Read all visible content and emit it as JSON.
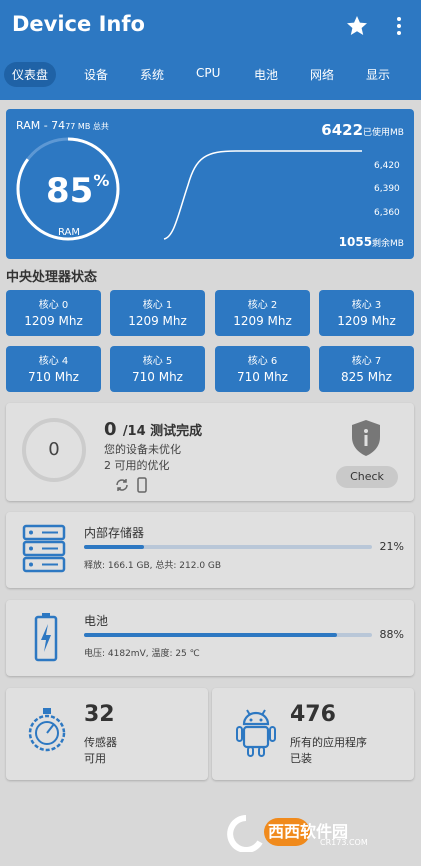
{
  "app": {
    "title": "Device Info"
  },
  "tabs": [
    "仪表盘",
    "设备",
    "系统",
    "CPU",
    "电池",
    "网络",
    "显示"
  ],
  "ram": {
    "label_prefix": "RAM - 74",
    "label_small": "77 MB 总共",
    "used_value": "6422",
    "used_unit": "已使用MB",
    "free_value": "1055",
    "free_unit": "剩余MB",
    "percent": "85",
    "percent_sign": "%",
    "ram_label": "RAM",
    "ticks": [
      "6,420",
      "6,390",
      "6,360"
    ],
    "gauge_fraction": 0.85
  },
  "cpu": {
    "title": "中央处理器状态",
    "cores": [
      {
        "name": "核心 0",
        "freq": "1209 Mhz"
      },
      {
        "name": "核心 1",
        "freq": "1209 Mhz"
      },
      {
        "name": "核心 2",
        "freq": "1209 Mhz"
      },
      {
        "name": "核心 3",
        "freq": "1209 Mhz"
      },
      {
        "name": "核心 4",
        "freq": "710 Mhz"
      },
      {
        "name": "核心 5",
        "freq": "710 Mhz"
      },
      {
        "name": "核心 6",
        "freq": "710 Mhz"
      },
      {
        "name": "核心 7",
        "freq": "825 Mhz"
      }
    ]
  },
  "test": {
    "circle_value": "0",
    "count": "0",
    "count_rest": "/14 测试完成",
    "line1": "您的设备未优化",
    "line2": "2 可用的优化",
    "check_label": "Check"
  },
  "storage": {
    "title": "内部存储器",
    "percent": "21%",
    "fraction": 0.21,
    "detail": "释放: 166.1 GB, 总共: 212.0 GB"
  },
  "battery": {
    "title": "电池",
    "percent": "88%",
    "fraction": 0.88,
    "detail": "电压: 4182mV, 温度: 25 ℃"
  },
  "sensors": {
    "count": "32",
    "line1": "传感器",
    "line2": "可用"
  },
  "apps": {
    "count": "476",
    "line1": "所有的应用程序",
    "line2": "已装"
  },
  "watermark": {
    "text": "西西软件园",
    "url": "CR173.COM"
  },
  "colors": {
    "primary": "#2d78c2",
    "background": "#d8d8d8",
    "card": "#e0e0e0"
  }
}
